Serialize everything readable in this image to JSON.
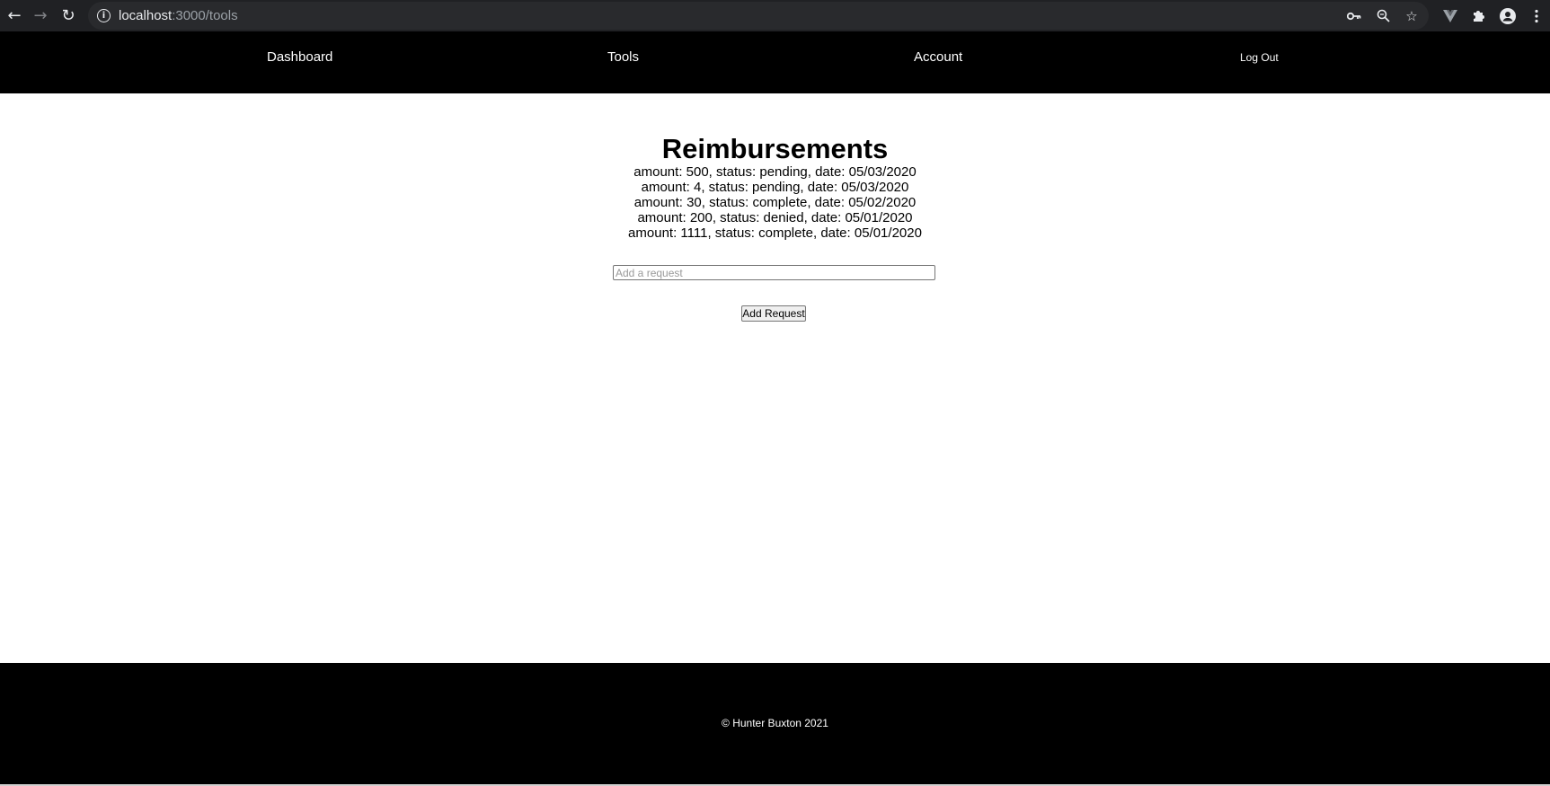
{
  "browser": {
    "url_host": "localhost",
    "url_path": ":3000/tools",
    "icons": {
      "back": "back-arrow-icon",
      "forward": "forward-arrow-icon",
      "reload": "reload-icon",
      "info": "info-icon",
      "key": "key-icon",
      "zoom": "zoom-icon",
      "star": "star-icon",
      "vue_devtools": "vue-devtools-icon",
      "extensions": "puzzle-icon",
      "profile": "profile-icon",
      "menu": "kebab-menu-icon"
    }
  },
  "nav": {
    "dashboard": "Dashboard",
    "tools": "Tools",
    "account": "Account",
    "logout": "Log Out"
  },
  "main": {
    "title": "Reimbursements",
    "items": [
      "amount: 500, status: pending, date: 05/03/2020",
      "amount: 4, status: pending, date: 05/03/2020",
      "amount: 30, status: complete, date: 05/02/2020",
      "amount: 200, status: denied, date: 05/01/2020",
      "amount: 1111, status: complete, date: 05/01/2020"
    ],
    "input_placeholder": "Add a request",
    "input_value": "",
    "add_button": "Add Request"
  },
  "footer": {
    "copyright": "© Hunter Buxton 2021"
  },
  "colors": {
    "browser_chrome": "#202124",
    "url_box": "#292a2d",
    "nav_bg": "#000000",
    "footer_bg": "#000000",
    "page_bg": "#ffffff"
  }
}
